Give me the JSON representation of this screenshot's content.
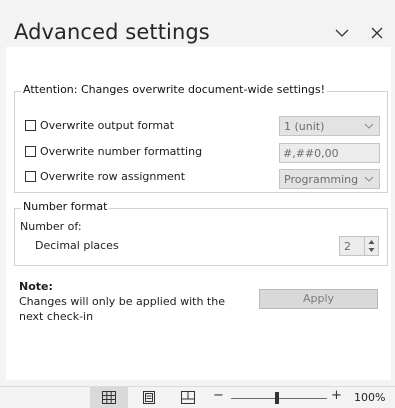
{
  "panel": {
    "title": "Advanced settings",
    "collapse_icon": "chevron-down-icon",
    "close_icon": "close-icon"
  },
  "overwrite_group": {
    "legend": "Attention: Changes overwrite document-wide settings!",
    "rows": [
      {
        "label": "Overwrite output format",
        "checked": false,
        "control_value": "1 (unit)"
      },
      {
        "label": "Overwrite number formatting",
        "checked": false,
        "control_value": "#,##0,00"
      },
      {
        "label": "Overwrite row assignment",
        "checked": false,
        "control_value": "Programming"
      }
    ]
  },
  "number_format": {
    "legend": "Number format",
    "sub_label": "Number of:",
    "decimal_label": "Decimal places",
    "decimal_value": "2"
  },
  "note": {
    "title": "Note:",
    "text": "Changes will only be applied with the next check-in"
  },
  "apply_label": "Apply",
  "statusbar": {
    "views": [
      "grid-view-icon",
      "page-view-icon",
      "reading-view-icon"
    ],
    "zoom_minus": "−",
    "zoom_plus": "+",
    "zoom_level": "100%"
  }
}
